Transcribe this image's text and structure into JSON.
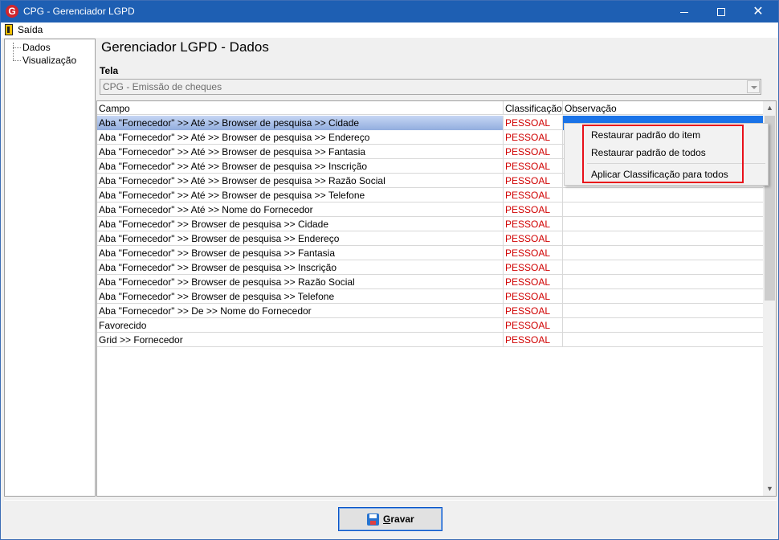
{
  "window": {
    "title": "CPG - Gerenciador LGPD"
  },
  "menu": {
    "exit_label": "Saída"
  },
  "tree": {
    "items": [
      "Dados",
      "Visualização"
    ]
  },
  "page": {
    "heading": "Gerenciador LGPD - Dados",
    "tela_label": "Tela",
    "tela_value": "CPG - Emissão de cheques"
  },
  "grid": {
    "columns": [
      "Campo",
      "Classificação",
      "Observação"
    ],
    "rows": [
      {
        "campo": "Aba \"Fornecedor\" >> Até >> Browser de pesquisa >> Cidade",
        "classificacao": "PESSOAL",
        "observacao": ""
      },
      {
        "campo": "Aba \"Fornecedor\" >> Até >> Browser de pesquisa >> Endereço",
        "classificacao": "PESSOAL",
        "observacao": ""
      },
      {
        "campo": "Aba \"Fornecedor\" >> Até >> Browser de pesquisa >> Fantasia",
        "classificacao": "PESSOAL",
        "observacao": ""
      },
      {
        "campo": "Aba \"Fornecedor\" >> Até >> Browser de pesquisa >> Inscrição",
        "classificacao": "PESSOAL",
        "observacao": ""
      },
      {
        "campo": "Aba \"Fornecedor\" >> Até >> Browser de pesquisa >> Razão Social",
        "classificacao": "PESSOAL",
        "observacao": ""
      },
      {
        "campo": "Aba \"Fornecedor\" >> Até >> Browser de pesquisa >> Telefone",
        "classificacao": "PESSOAL",
        "observacao": ""
      },
      {
        "campo": "Aba \"Fornecedor\" >> Até >> Nome do Fornecedor",
        "classificacao": "PESSOAL",
        "observacao": ""
      },
      {
        "campo": "Aba \"Fornecedor\" >> Browser de pesquisa >> Cidade",
        "classificacao": "PESSOAL",
        "observacao": ""
      },
      {
        "campo": "Aba \"Fornecedor\" >> Browser de pesquisa >> Endereço",
        "classificacao": "PESSOAL",
        "observacao": ""
      },
      {
        "campo": "Aba \"Fornecedor\" >> Browser de pesquisa >> Fantasia",
        "classificacao": "PESSOAL",
        "observacao": ""
      },
      {
        "campo": "Aba \"Fornecedor\" >> Browser de pesquisa >> Inscrição",
        "classificacao": "PESSOAL",
        "observacao": ""
      },
      {
        "campo": "Aba \"Fornecedor\" >> Browser de pesquisa >> Razão Social",
        "classificacao": "PESSOAL",
        "observacao": ""
      },
      {
        "campo": "Aba \"Fornecedor\" >> Browser de pesquisa >> Telefone",
        "classificacao": "PESSOAL",
        "observacao": ""
      },
      {
        "campo": "Aba \"Fornecedor\" >> De >> Nome do Fornecedor",
        "classificacao": "PESSOAL",
        "observacao": ""
      },
      {
        "campo": "Favorecido",
        "classificacao": "PESSOAL",
        "observacao": ""
      },
      {
        "campo": "Grid >> Fornecedor",
        "classificacao": "PESSOAL",
        "observacao": ""
      }
    ]
  },
  "context_menu": {
    "items": [
      "Restaurar padrão do item",
      "Restaurar padrão de todos",
      "Aplicar Classificação para todos"
    ]
  },
  "footer": {
    "save_label": "Gravar"
  },
  "colors": {
    "titlebar": "#1e5fb3",
    "classification_text": "#d00000",
    "selection": "#1a73e8",
    "highlight_box": "#e8101a"
  }
}
